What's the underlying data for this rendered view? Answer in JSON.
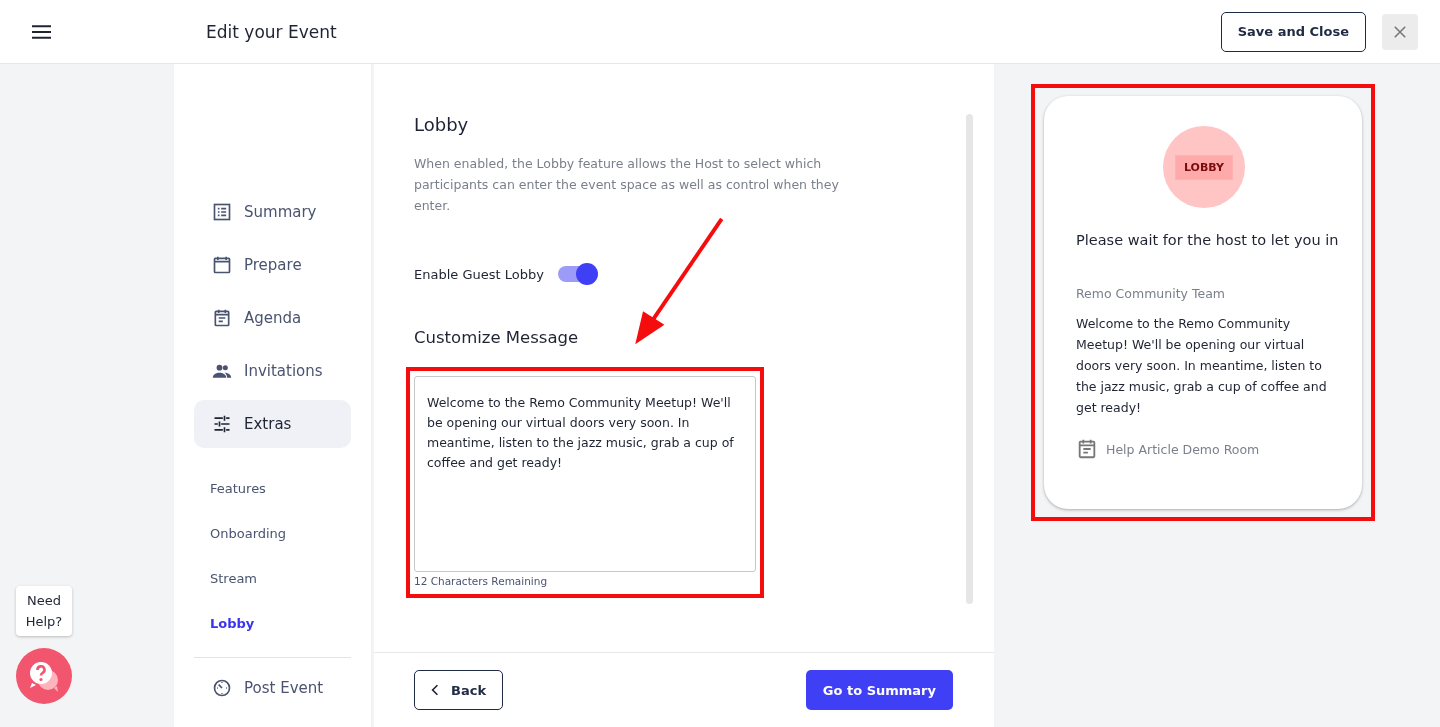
{
  "header": {
    "title": "Edit your Event",
    "save_button": "Save and Close"
  },
  "sidebar": {
    "items": [
      {
        "label": "Summary",
        "kind": "list",
        "selected": false
      },
      {
        "label": "Prepare",
        "kind": "calendar",
        "selected": false
      },
      {
        "label": "Agenda",
        "kind": "agenda",
        "selected": false
      },
      {
        "label": "Invitations",
        "kind": "people",
        "selected": false
      },
      {
        "label": "Extras",
        "kind": "sliders",
        "selected": true,
        "children": [
          {
            "label": "Features",
            "selected": false
          },
          {
            "label": "Onboarding",
            "selected": false
          },
          {
            "label": "Stream",
            "selected": false
          },
          {
            "label": "Lobby",
            "selected": true
          }
        ]
      }
    ],
    "footer_item": {
      "label": "Post Event",
      "kind": "timer",
      "selected": false
    }
  },
  "content": {
    "title": "Lobby",
    "description": "When enabled, the Lobby feature allows the Host to select which participants can enter the event space as well as control when they enter.",
    "toggle": {
      "label": "Enable Guest Lobby",
      "on": true
    },
    "message_heading": "Customize Message",
    "message": "Welcome to the Remo Community Meetup! We'll be opening our virtual doors very soon. In meantime, listen to the jazz music, grab a cup of coffee and get ready!",
    "remaining": "12 Characters Remaining",
    "back_button": "Back",
    "next_button": "Go to Summary"
  },
  "preview": {
    "badge_label": "LOBBY",
    "heading": "Please wait for the host to let you in",
    "sender": "Remo Community Team",
    "message": "Welcome to the Remo Community Meetup! We'll be opening our virtual doors very soon. In meantime, listen to the jazz music, grab a cup of coffee and get ready!",
    "room": "Help Article Demo Room"
  },
  "help_widget": {
    "tooltip": "Need Help?"
  }
}
